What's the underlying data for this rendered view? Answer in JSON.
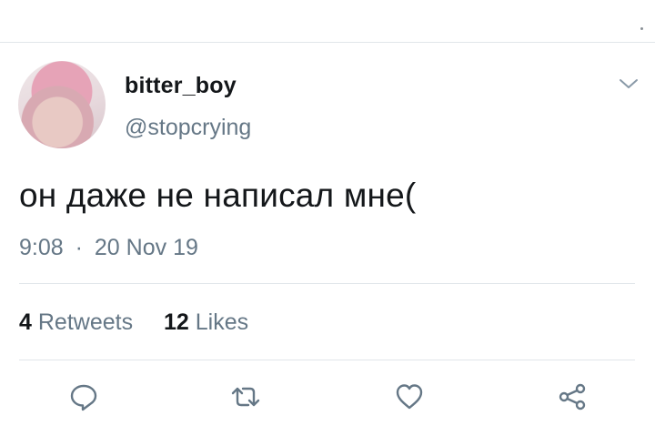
{
  "tweet": {
    "display_name": "bitter_boy",
    "handle": "@stopcrying",
    "text": "он даже не написал мне(",
    "time": "9:08",
    "separator": "·",
    "date": "20 Nov 19"
  },
  "stats": {
    "retweets_count": "4",
    "retweets_label": "Retweets",
    "likes_count": "12",
    "likes_label": "Likes"
  },
  "icons": {
    "menu": "chevron-down-icon",
    "reply": "reply-icon",
    "retweet": "retweet-icon",
    "like": "heart-icon",
    "share": "share-icon"
  },
  "colors": {
    "icon": "#657786",
    "text_primary": "#14171a",
    "text_secondary": "#657786",
    "divider": "#e1e6ea"
  }
}
